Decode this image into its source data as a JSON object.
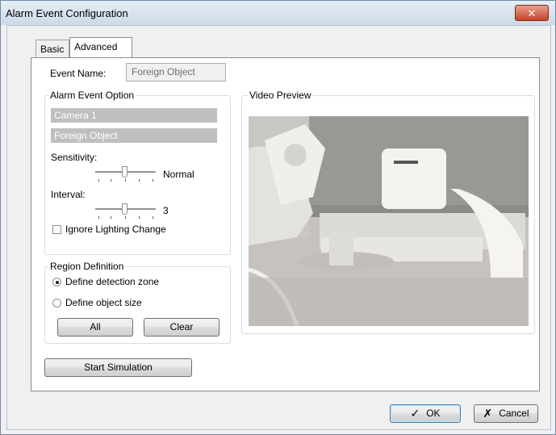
{
  "window": {
    "title": "Alarm Event Configuration",
    "close_icon": "close-icon"
  },
  "tabs": [
    {
      "label": "Basic",
      "selected": false
    },
    {
      "label": "Advanced",
      "selected": true
    }
  ],
  "event_name": {
    "label": "Event Name:",
    "value": "Foreign Object"
  },
  "alarm_event_option": {
    "legend": "Alarm Event Option",
    "camera": "Camera 1",
    "event_type": "Foreign Object",
    "sensitivity": {
      "label": "Sensitivity:",
      "value_text": "Normal"
    },
    "interval": {
      "label": "Interval:",
      "value_text": "3"
    },
    "ignore_lighting": {
      "label": "Ignore Lighting Change",
      "checked": false
    }
  },
  "region_definition": {
    "legend": "Region Definition",
    "options": [
      {
        "label": "Define detection zone",
        "selected": true
      },
      {
        "label": "Define object size",
        "selected": false
      }
    ],
    "all_button": "All",
    "clear_button": "Clear"
  },
  "start_simulation_button": "Start Simulation",
  "video_preview": {
    "legend": "Video Preview"
  },
  "footer": {
    "ok_button": "OK",
    "cancel_button": "Cancel",
    "ok_icon": "checkmark-icon",
    "cancel_icon": "x-icon"
  }
}
